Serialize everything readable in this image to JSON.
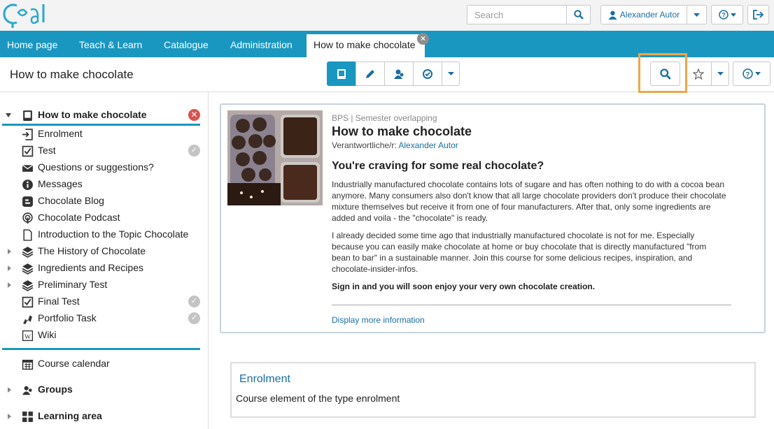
{
  "header": {
    "logo_text": "OpenOlat",
    "search_placeholder": "Search",
    "user_name": "Alexander Autor"
  },
  "nav": {
    "tabs": [
      "Home page",
      "Teach & Learn",
      "Catalogue",
      "Administration"
    ],
    "active_tab": "How to make chocolate"
  },
  "toolbar": {
    "course_title": "How to make chocolate"
  },
  "sidebar": {
    "root": "How to make chocolate",
    "items": [
      {
        "label": "Enrolment",
        "icon": "enrolment-icon"
      },
      {
        "label": "Test",
        "icon": "checkbox-icon",
        "done": true
      },
      {
        "label": "Questions or suggestions?",
        "icon": "envelope-icon"
      },
      {
        "label": "Messages",
        "icon": "info-icon"
      },
      {
        "label": "Chocolate Blog",
        "icon": "blog-icon"
      },
      {
        "label": "Chocolate Podcast",
        "icon": "podcast-icon"
      },
      {
        "label": "Introduction to the Topic Chocolate",
        "icon": "page-icon"
      },
      {
        "label": "The History of Chocolate",
        "icon": "stack-icon",
        "expandable": true
      },
      {
        "label": "Ingredients and Recipes",
        "icon": "stack-icon",
        "expandable": true
      },
      {
        "label": "Preliminary Test",
        "icon": "stack-icon",
        "expandable": true
      },
      {
        "label": "Final Test",
        "icon": "checkbox-icon",
        "done": true
      },
      {
        "label": "Portfolio Task",
        "icon": "portfolio-icon",
        "done": true
      },
      {
        "label": "Wiki",
        "icon": "wiki-icon"
      }
    ],
    "calendar": "Course calendar",
    "groups": "Groups",
    "learning_area": "Learning area"
  },
  "course_info": {
    "meta": "BPS | Semester overlapping",
    "title": "How to make chocolate",
    "responsible_label": "Verantwortliche/r:",
    "responsible_name": "Alexander Autor",
    "heading": "You're craving for some real chocolate?",
    "para1": "Industrially manufactured chocolate contains lots of sugare and has often nothing to do with a cocoa bean anymore. Many consumers also don't know that all large chocolate providers don't produce their chocolate mixture themselves but receive it from one of four manufacturers. After that, only some ingredients are added and voila - the \"chocolate\" is ready.",
    "para2": "I already decided some time ago that industrially manufactured chocolate is not for me. Especially because you can easily make chocolate at home or buy chocolate that is directly manufactured \"from bean to bar\" in a sustainable manner. Join this course for some delicious recipes, inspiration, and chocolate-insider-infos.",
    "signin": "Sign in and you will soon enjoy your very own chocolate creation.",
    "more_link": "Display more information"
  },
  "enrolment": {
    "title": "Enrolment",
    "description": "Course element of the type enrolment"
  },
  "colors": {
    "brand": "#1a97c0",
    "link": "#1a6fa0",
    "highlight": "#f0a54a"
  }
}
